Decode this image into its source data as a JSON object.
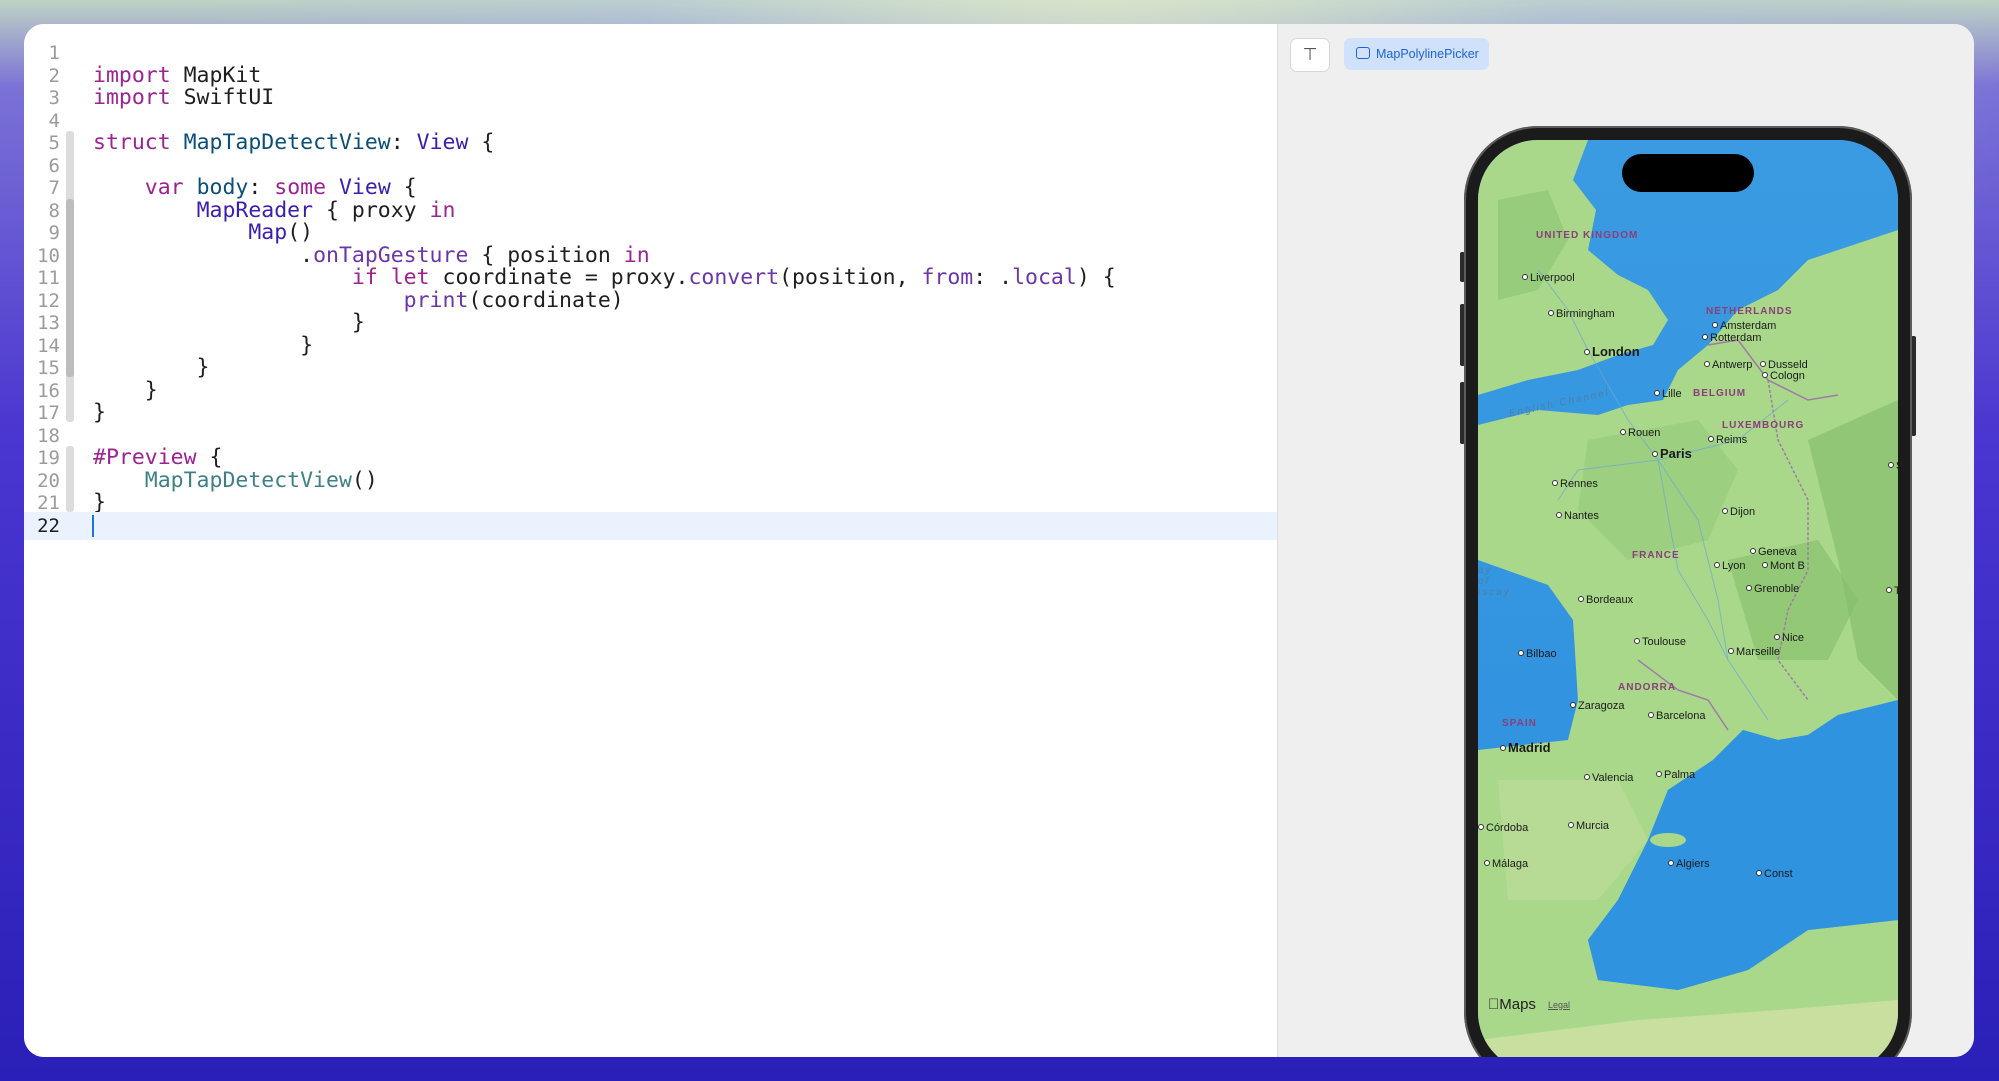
{
  "editor": {
    "current_line": 22,
    "lines": [
      {
        "n": "1",
        "tokens": []
      },
      {
        "n": "2",
        "tokens": [
          {
            "t": "import",
            "c": "kw"
          },
          {
            "t": " MapKit",
            "c": ""
          }
        ]
      },
      {
        "n": "3",
        "tokens": [
          {
            "t": "import",
            "c": "kw"
          },
          {
            "t": " SwiftUI",
            "c": ""
          }
        ]
      },
      {
        "n": "4",
        "tokens": []
      },
      {
        "n": "5",
        "tokens": [
          {
            "t": "struct",
            "c": "kw"
          },
          {
            "t": " ",
            "c": ""
          },
          {
            "t": "MapTapDetectView",
            "c": "dc"
          },
          {
            "t": ": ",
            "c": ""
          },
          {
            "t": "View",
            "c": "ty"
          },
          {
            "t": " {",
            "c": ""
          }
        ]
      },
      {
        "n": "6",
        "tokens": []
      },
      {
        "n": "7",
        "tokens": [
          {
            "t": "    ",
            "c": ""
          },
          {
            "t": "var",
            "c": "kw"
          },
          {
            "t": " ",
            "c": ""
          },
          {
            "t": "body",
            "c": "dc"
          },
          {
            "t": ": ",
            "c": ""
          },
          {
            "t": "some",
            "c": "kw"
          },
          {
            "t": " ",
            "c": ""
          },
          {
            "t": "View",
            "c": "ty"
          },
          {
            "t": " {",
            "c": ""
          }
        ]
      },
      {
        "n": "8",
        "tokens": [
          {
            "t": "        ",
            "c": ""
          },
          {
            "t": "MapReader",
            "c": "ty"
          },
          {
            "t": " { proxy ",
            "c": ""
          },
          {
            "t": "in",
            "c": "kw"
          }
        ]
      },
      {
        "n": "9",
        "tokens": [
          {
            "t": "            ",
            "c": ""
          },
          {
            "t": "Map",
            "c": "ty"
          },
          {
            "t": "()",
            "c": ""
          }
        ]
      },
      {
        "n": "10",
        "tokens": [
          {
            "t": "                .",
            "c": ""
          },
          {
            "t": "onTapGesture",
            "c": "mt"
          },
          {
            "t": " { position ",
            "c": ""
          },
          {
            "t": "in",
            "c": "kw"
          }
        ]
      },
      {
        "n": "11",
        "tokens": [
          {
            "t": "                    ",
            "c": ""
          },
          {
            "t": "if",
            "c": "kw"
          },
          {
            "t": " ",
            "c": ""
          },
          {
            "t": "let",
            "c": "kw"
          },
          {
            "t": " coordinate = proxy.",
            "c": ""
          },
          {
            "t": "convert",
            "c": "mt"
          },
          {
            "t": "(position, ",
            "c": ""
          },
          {
            "t": "from",
            "c": "mt"
          },
          {
            "t": ": .",
            "c": ""
          },
          {
            "t": "local",
            "c": "mt"
          },
          {
            "t": ") {",
            "c": ""
          }
        ]
      },
      {
        "n": "12",
        "tokens": [
          {
            "t": "                        ",
            "c": ""
          },
          {
            "t": "print",
            "c": "mt"
          },
          {
            "t": "(coordinate)",
            "c": ""
          }
        ]
      },
      {
        "n": "13",
        "tokens": [
          {
            "t": "                    }",
            "c": ""
          }
        ]
      },
      {
        "n": "14",
        "tokens": [
          {
            "t": "                }",
            "c": ""
          }
        ]
      },
      {
        "n": "15",
        "tokens": [
          {
            "t": "        }",
            "c": ""
          }
        ]
      },
      {
        "n": "16",
        "tokens": [
          {
            "t": "    }",
            "c": ""
          }
        ]
      },
      {
        "n": "17",
        "tokens": [
          {
            "t": "}",
            "c": ""
          }
        ]
      },
      {
        "n": "18",
        "tokens": []
      },
      {
        "n": "19",
        "tokens": [
          {
            "t": "#Preview",
            "c": "kw"
          },
          {
            "t": " {",
            "c": ""
          }
        ]
      },
      {
        "n": "20",
        "tokens": [
          {
            "t": "    ",
            "c": ""
          },
          {
            "t": "MapTapDetectView",
            "c": "fn"
          },
          {
            "t": "()",
            "c": ""
          }
        ]
      },
      {
        "n": "21",
        "tokens": [
          {
            "t": "}",
            "c": ""
          }
        ]
      },
      {
        "n": "22",
        "tokens": []
      }
    ]
  },
  "preview": {
    "pin_icon": "pin-icon",
    "chip_label": "MapPolylinePicker",
    "chip_icon": "window-icon",
    "map": {
      "maps_logo": "Maps",
      "legal": "Legal",
      "countries": [
        {
          "name": "UNITED KINGDOM",
          "key": "uk"
        },
        {
          "name": "NETHERLANDS",
          "key": "nl"
        },
        {
          "name": "BELGIUM",
          "key": "be"
        },
        {
          "name": "LUXEMBOURG",
          "key": "lu"
        },
        {
          "name": "FRANCE",
          "key": "fr"
        },
        {
          "name": "ANDORRA",
          "key": "ad"
        },
        {
          "name": "SPAIN",
          "key": "es"
        }
      ],
      "water": [
        {
          "name": "English Channel",
          "key": "channel"
        },
        {
          "name": "ay of iscay",
          "key": "biscay"
        }
      ],
      "cities": [
        {
          "name": "Liverpool",
          "key": "liverpool"
        },
        {
          "name": "Birmingham",
          "key": "birmingham"
        },
        {
          "name": "London",
          "key": "london",
          "major": true
        },
        {
          "name": "Amsterdam",
          "key": "amsterdam"
        },
        {
          "name": "Rotterdam",
          "key": "rotterdam"
        },
        {
          "name": "Antwerp",
          "key": "antwerp"
        },
        {
          "name": "Dusseld",
          "key": "dusseldorf"
        },
        {
          "name": "Cologn",
          "key": "cologne"
        },
        {
          "name": "Lille",
          "key": "lille"
        },
        {
          "name": "Rouen",
          "key": "rouen"
        },
        {
          "name": "Paris",
          "key": "paris",
          "major": true
        },
        {
          "name": "Reims",
          "key": "reims"
        },
        {
          "name": "Str",
          "key": "strasbourg"
        },
        {
          "name": "Rennes",
          "key": "rennes"
        },
        {
          "name": "Nantes",
          "key": "nantes"
        },
        {
          "name": "Dijon",
          "key": "dijon"
        },
        {
          "name": "Geneva",
          "key": "geneva"
        },
        {
          "name": "Lyon",
          "key": "lyon"
        },
        {
          "name": "Mont B",
          "key": "montblanc"
        },
        {
          "name": "Grenoble",
          "key": "grenoble"
        },
        {
          "name": "Tur",
          "key": "turin"
        },
        {
          "name": "Bordeaux",
          "key": "bordeaux"
        },
        {
          "name": "Toulouse",
          "key": "toulouse"
        },
        {
          "name": "Nice",
          "key": "nice"
        },
        {
          "name": "Marseille",
          "key": "marseille"
        },
        {
          "name": "Bilbao",
          "key": "bilbao"
        },
        {
          "name": "Zaragoza",
          "key": "zaragoza"
        },
        {
          "name": "Barcelona",
          "key": "barcelona"
        },
        {
          "name": "Madrid",
          "key": "madrid",
          "major": true
        },
        {
          "name": "Valencia",
          "key": "valencia"
        },
        {
          "name": "Palma",
          "key": "palma"
        },
        {
          "name": "Córdoba",
          "key": "cordoba"
        },
        {
          "name": "Murcia",
          "key": "murcia"
        },
        {
          "name": "Málaga",
          "key": "malaga"
        },
        {
          "name": "Algiers",
          "key": "algiers"
        },
        {
          "name": "Const",
          "key": "constantine"
        }
      ]
    }
  }
}
